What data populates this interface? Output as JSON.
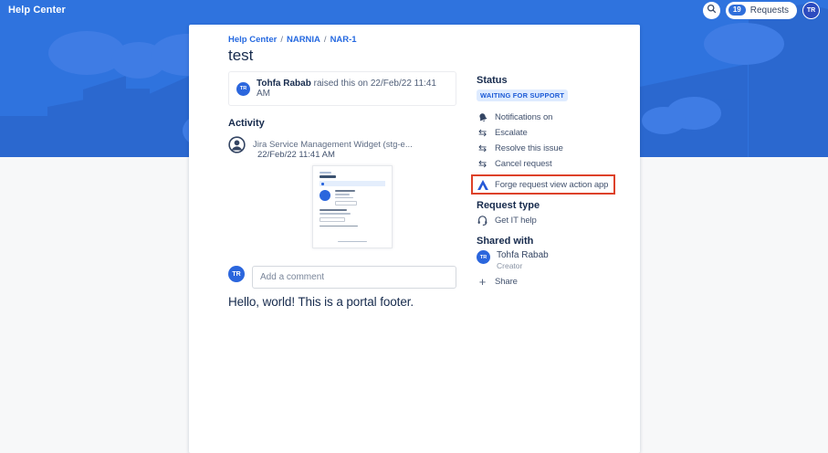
{
  "header": {
    "brand": "Help Center",
    "requests_count": "19",
    "requests_label": "Requests",
    "user_initials": "TR"
  },
  "breadcrumb": {
    "items": [
      "Help Center",
      "NARNIA",
      "NAR-1"
    ],
    "separator": "/"
  },
  "request": {
    "title": "test",
    "reporter_initials": "TR",
    "reporter_name": "Tohfa Rabab",
    "raised_text": "raised this on 22/Feb/22 11:41 AM"
  },
  "activity": {
    "heading": "Activity",
    "entry": {
      "author": "Jira Service Management Widget (stg-e...",
      "timestamp": "22/Feb/22 11:41 AM"
    }
  },
  "comment": {
    "user_initials": "TR",
    "placeholder": "Add a comment"
  },
  "portal_footer": "Hello, world! This is a portal footer.",
  "sidebar": {
    "status": {
      "heading": "Status",
      "badge": "WAITING FOR SUPPORT"
    },
    "actions": [
      {
        "label": "Notifications on",
        "icon": "bell-icon"
      },
      {
        "label": "Escalate",
        "icon": "transition-icon"
      },
      {
        "label": "Resolve this issue",
        "icon": "transition-icon"
      },
      {
        "label": "Cancel request",
        "icon": "transition-icon"
      },
      {
        "label": "Forge request view action app",
        "icon": "forge-icon",
        "highlighted": true
      }
    ],
    "request_type": {
      "heading": "Request type",
      "value": "Get IT help",
      "icon": "headset-icon"
    },
    "shared_with": {
      "heading": "Shared with",
      "person": {
        "initials": "TR",
        "name": "Tohfa Rabab",
        "role": "Creator"
      },
      "share_label": "Share"
    }
  },
  "icons": {
    "transition_glyph": "⇆",
    "plus_glyph": "+"
  },
  "colors": {
    "banner_blue": "#2f73de",
    "building_blue": "#2b68cf",
    "cloud_blue": "#3f7ce4",
    "link_blue": "#2569e0",
    "avatar_blue": "#2b66dd",
    "header_avatar_blue": "#2c4bbf",
    "status_badge_bg": "#deebff",
    "status_badge_text": "#1d5bd6",
    "highlight_red": "#dd4128",
    "text_dark": "#172b4d",
    "text_muted": "#505f79"
  }
}
